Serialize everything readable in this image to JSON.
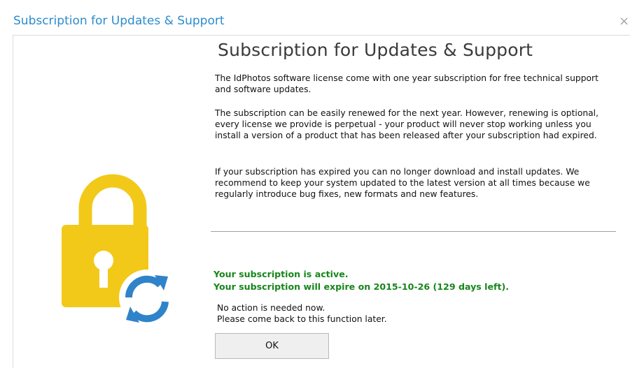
{
  "window": {
    "title": "Subscription for Updates & Support",
    "close_glyph": "×"
  },
  "content": {
    "heading": "Subscription for Updates & Support",
    "paragraphs": [
      "The IdPhotos software license come with one year subscription for free technical support and software updates.",
      "The subscription can be easily renewed for the next year. However, renewing is optional, every license we provide is perpetual - your product will never stop working unless you install a version of a product that has been released after your subscription had expired.",
      "If your subscription has expired you can no longer download and install updates. We recommend to keep your system updated to the latest version at all times because we regularly introduce bug fixes, new formats and new features."
    ],
    "status": {
      "active": "Your subscription is active.",
      "expiry": "Your subscription will expire on 2015-10-26 (129 days left)."
    },
    "notes": [
      "No action is needed now.",
      "Please come back to this function later."
    ],
    "ok_label": "OK"
  },
  "icons": {
    "lock": "padlock-with-refresh-icon",
    "refresh": "refresh-arrows-icon"
  },
  "colors": {
    "title": "#2b8ccf",
    "lock_body": "#f2c919",
    "refresh": "#2f83c9",
    "status_green": "#17861b"
  }
}
